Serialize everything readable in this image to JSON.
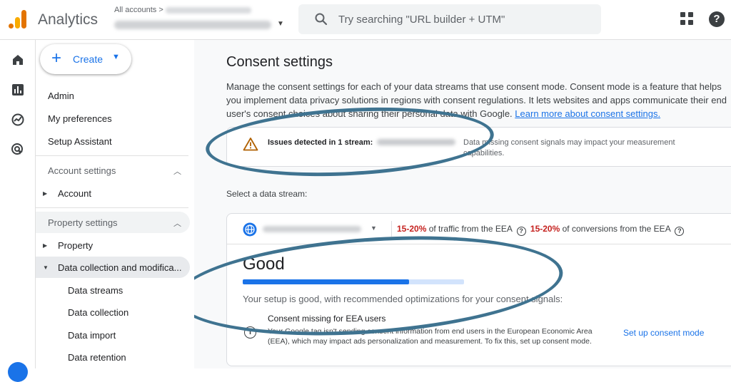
{
  "app": {
    "name": "Analytics"
  },
  "header": {
    "breadcrumb": "All accounts",
    "breadcrumb_sep": ">",
    "search_placeholder": "Try searching \"URL builder + UTM\""
  },
  "nav": {
    "create_label": "Create",
    "admin": "Admin",
    "my_preferences": "My preferences",
    "setup_assistant": "Setup Assistant",
    "account_settings": "Account settings",
    "account": "Account",
    "property_settings": "Property settings",
    "property": "Property",
    "data_collection": "Data collection and modifica...",
    "sub_items": [
      "Data streams",
      "Data collection",
      "Data import",
      "Data retention"
    ]
  },
  "main": {
    "title": "Consent settings",
    "description": "Manage the consent settings for each of your data streams that use consent mode. Consent mode is a feature that helps you implement data privacy solutions in regions with consent regulations. It lets websites and apps communicate their end user's consent choices about sharing their personal data with Google.",
    "learn_more": "Learn more about consent settings.",
    "issue_title": "Issues detected in 1 stream:",
    "issue_message": "Data missing consent signals may impact your measurement capabilities.",
    "select_label": "Select a data stream:",
    "traffic_pct": "15-20%",
    "traffic_text": "of traffic from the EEA",
    "conversions_pct": "15-20%",
    "conversions_text": "of conversions from the EEA",
    "status": "Good",
    "status_progress": 0.75,
    "status_text": "Your setup is good, with recommended optimizations for your consent signals:",
    "consent_heading": "Consent missing for EEA users",
    "consent_detail": "Your Google tag isn't sending consent information from end users in the European Economic Area (EEA), which may impact ads personalization and measurement. To fix this, set up consent mode.",
    "setup_link": "Set up consent mode"
  },
  "colors": {
    "accent": "#1a73e8",
    "warning_red": "#c5221f",
    "annotation": "#3f7390"
  }
}
